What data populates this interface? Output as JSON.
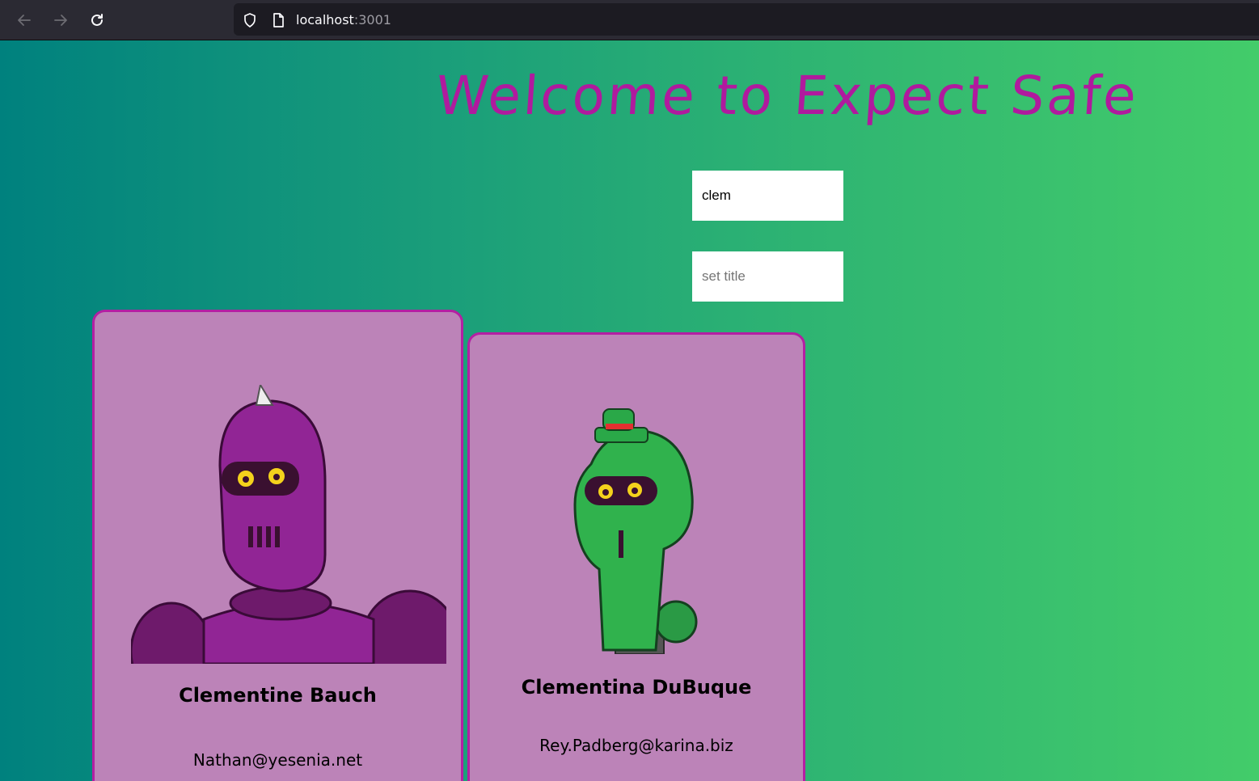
{
  "browser": {
    "url_host": "localhost",
    "url_port": ":3001"
  },
  "page": {
    "heading": "Welcome to Expect Safe",
    "search": {
      "value": "clem"
    },
    "title_input": {
      "placeholder": "set title"
    }
  },
  "cards": [
    {
      "name": "Clementine Bauch",
      "email": "Nathan@yesenia.net"
    },
    {
      "name": "Clementina DuBuque",
      "email": "Rey.Padberg@karina.biz"
    }
  ],
  "colors": {
    "heading": "#b01a9e",
    "card_bg": "#bc83b8",
    "card_border": "#b41fa3"
  }
}
